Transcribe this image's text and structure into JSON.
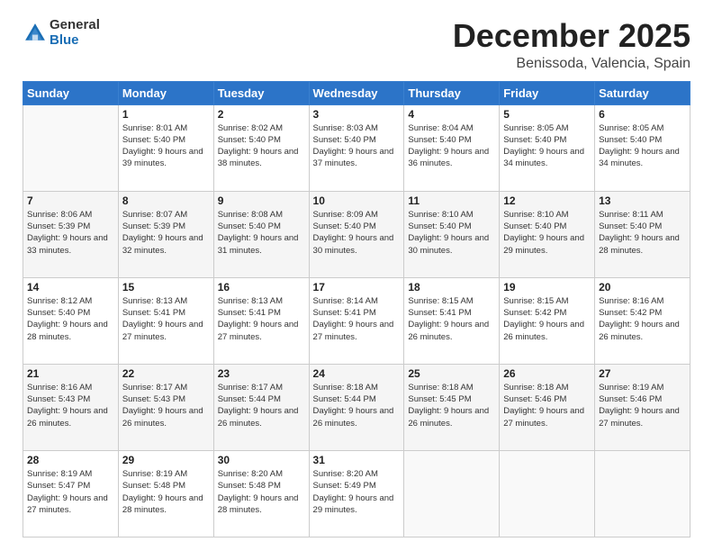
{
  "logo": {
    "text_general": "General",
    "text_blue": "Blue"
  },
  "title": "December 2025",
  "subtitle": "Benissoda, Valencia, Spain",
  "days_header": [
    "Sunday",
    "Monday",
    "Tuesday",
    "Wednesday",
    "Thursday",
    "Friday",
    "Saturday"
  ],
  "weeks": [
    [
      {
        "day": "",
        "sunrise": "",
        "sunset": "",
        "daylight": ""
      },
      {
        "day": "1",
        "sunrise": "Sunrise: 8:01 AM",
        "sunset": "Sunset: 5:40 PM",
        "daylight": "Daylight: 9 hours and 39 minutes."
      },
      {
        "day": "2",
        "sunrise": "Sunrise: 8:02 AM",
        "sunset": "Sunset: 5:40 PM",
        "daylight": "Daylight: 9 hours and 38 minutes."
      },
      {
        "day": "3",
        "sunrise": "Sunrise: 8:03 AM",
        "sunset": "Sunset: 5:40 PM",
        "daylight": "Daylight: 9 hours and 37 minutes."
      },
      {
        "day": "4",
        "sunrise": "Sunrise: 8:04 AM",
        "sunset": "Sunset: 5:40 PM",
        "daylight": "Daylight: 9 hours and 36 minutes."
      },
      {
        "day": "5",
        "sunrise": "Sunrise: 8:05 AM",
        "sunset": "Sunset: 5:40 PM",
        "daylight": "Daylight: 9 hours and 34 minutes."
      },
      {
        "day": "6",
        "sunrise": "Sunrise: 8:05 AM",
        "sunset": "Sunset: 5:40 PM",
        "daylight": "Daylight: 9 hours and 34 minutes."
      }
    ],
    [
      {
        "day": "7",
        "sunrise": "Sunrise: 8:06 AM",
        "sunset": "Sunset: 5:39 PM",
        "daylight": "Daylight: 9 hours and 33 minutes."
      },
      {
        "day": "8",
        "sunrise": "Sunrise: 8:07 AM",
        "sunset": "Sunset: 5:39 PM",
        "daylight": "Daylight: 9 hours and 32 minutes."
      },
      {
        "day": "9",
        "sunrise": "Sunrise: 8:08 AM",
        "sunset": "Sunset: 5:40 PM",
        "daylight": "Daylight: 9 hours and 31 minutes."
      },
      {
        "day": "10",
        "sunrise": "Sunrise: 8:09 AM",
        "sunset": "Sunset: 5:40 PM",
        "daylight": "Daylight: 9 hours and 30 minutes."
      },
      {
        "day": "11",
        "sunrise": "Sunrise: 8:10 AM",
        "sunset": "Sunset: 5:40 PM",
        "daylight": "Daylight: 9 hours and 30 minutes."
      },
      {
        "day": "12",
        "sunrise": "Sunrise: 8:10 AM",
        "sunset": "Sunset: 5:40 PM",
        "daylight": "Daylight: 9 hours and 29 minutes."
      },
      {
        "day": "13",
        "sunrise": "Sunrise: 8:11 AM",
        "sunset": "Sunset: 5:40 PM",
        "daylight": "Daylight: 9 hours and 28 minutes."
      }
    ],
    [
      {
        "day": "14",
        "sunrise": "Sunrise: 8:12 AM",
        "sunset": "Sunset: 5:40 PM",
        "daylight": "Daylight: 9 hours and 28 minutes."
      },
      {
        "day": "15",
        "sunrise": "Sunrise: 8:13 AM",
        "sunset": "Sunset: 5:41 PM",
        "daylight": "Daylight: 9 hours and 27 minutes."
      },
      {
        "day": "16",
        "sunrise": "Sunrise: 8:13 AM",
        "sunset": "Sunset: 5:41 PM",
        "daylight": "Daylight: 9 hours and 27 minutes."
      },
      {
        "day": "17",
        "sunrise": "Sunrise: 8:14 AM",
        "sunset": "Sunset: 5:41 PM",
        "daylight": "Daylight: 9 hours and 27 minutes."
      },
      {
        "day": "18",
        "sunrise": "Sunrise: 8:15 AM",
        "sunset": "Sunset: 5:41 PM",
        "daylight": "Daylight: 9 hours and 26 minutes."
      },
      {
        "day": "19",
        "sunrise": "Sunrise: 8:15 AM",
        "sunset": "Sunset: 5:42 PM",
        "daylight": "Daylight: 9 hours and 26 minutes."
      },
      {
        "day": "20",
        "sunrise": "Sunrise: 8:16 AM",
        "sunset": "Sunset: 5:42 PM",
        "daylight": "Daylight: 9 hours and 26 minutes."
      }
    ],
    [
      {
        "day": "21",
        "sunrise": "Sunrise: 8:16 AM",
        "sunset": "Sunset: 5:43 PM",
        "daylight": "Daylight: 9 hours and 26 minutes."
      },
      {
        "day": "22",
        "sunrise": "Sunrise: 8:17 AM",
        "sunset": "Sunset: 5:43 PM",
        "daylight": "Daylight: 9 hours and 26 minutes."
      },
      {
        "day": "23",
        "sunrise": "Sunrise: 8:17 AM",
        "sunset": "Sunset: 5:44 PM",
        "daylight": "Daylight: 9 hours and 26 minutes."
      },
      {
        "day": "24",
        "sunrise": "Sunrise: 8:18 AM",
        "sunset": "Sunset: 5:44 PM",
        "daylight": "Daylight: 9 hours and 26 minutes."
      },
      {
        "day": "25",
        "sunrise": "Sunrise: 8:18 AM",
        "sunset": "Sunset: 5:45 PM",
        "daylight": "Daylight: 9 hours and 26 minutes."
      },
      {
        "day": "26",
        "sunrise": "Sunrise: 8:18 AM",
        "sunset": "Sunset: 5:46 PM",
        "daylight": "Daylight: 9 hours and 27 minutes."
      },
      {
        "day": "27",
        "sunrise": "Sunrise: 8:19 AM",
        "sunset": "Sunset: 5:46 PM",
        "daylight": "Daylight: 9 hours and 27 minutes."
      }
    ],
    [
      {
        "day": "28",
        "sunrise": "Sunrise: 8:19 AM",
        "sunset": "Sunset: 5:47 PM",
        "daylight": "Daylight: 9 hours and 27 minutes."
      },
      {
        "day": "29",
        "sunrise": "Sunrise: 8:19 AM",
        "sunset": "Sunset: 5:48 PM",
        "daylight": "Daylight: 9 hours and 28 minutes."
      },
      {
        "day": "30",
        "sunrise": "Sunrise: 8:20 AM",
        "sunset": "Sunset: 5:48 PM",
        "daylight": "Daylight: 9 hours and 28 minutes."
      },
      {
        "day": "31",
        "sunrise": "Sunrise: 8:20 AM",
        "sunset": "Sunset: 5:49 PM",
        "daylight": "Daylight: 9 hours and 29 minutes."
      },
      {
        "day": "",
        "sunrise": "",
        "sunset": "",
        "daylight": ""
      },
      {
        "day": "",
        "sunrise": "",
        "sunset": "",
        "daylight": ""
      },
      {
        "day": "",
        "sunrise": "",
        "sunset": "",
        "daylight": ""
      }
    ]
  ]
}
